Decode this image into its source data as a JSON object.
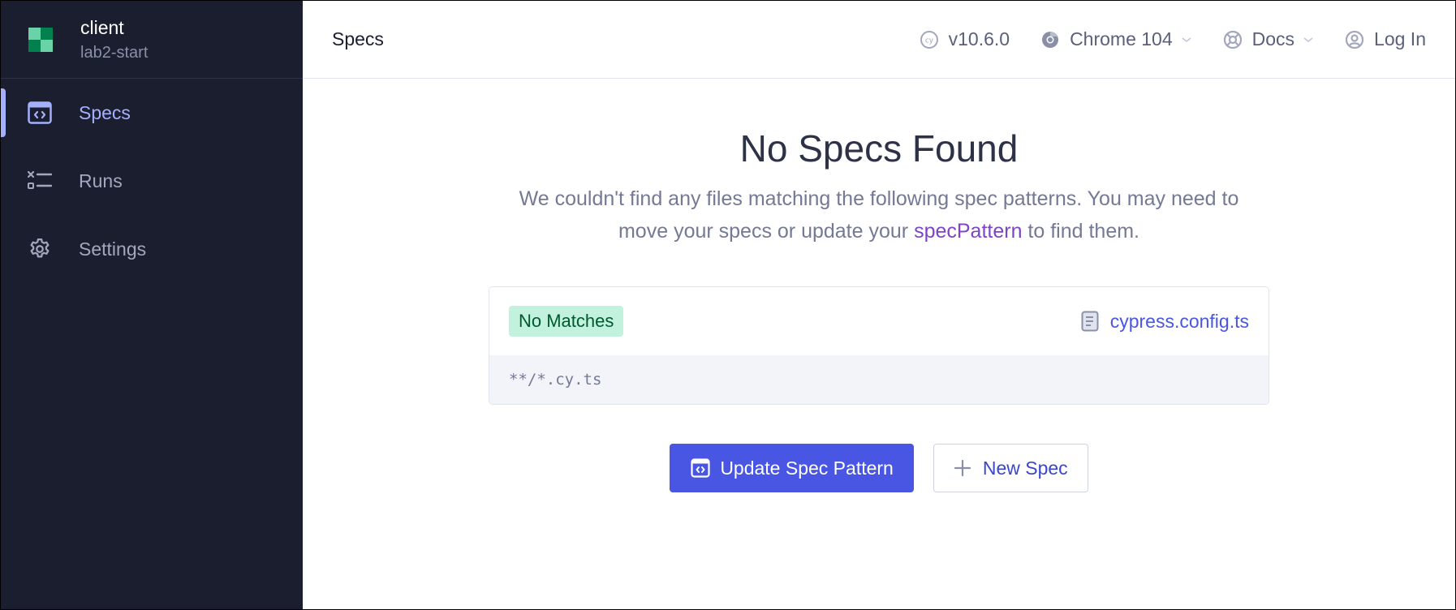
{
  "sidebar": {
    "project": {
      "name": "client",
      "branch": "lab2-start"
    },
    "items": [
      {
        "label": "Specs",
        "icon": "code-window-icon",
        "active": true
      },
      {
        "label": "Runs",
        "icon": "runs-list-icon",
        "active": false
      },
      {
        "label": "Settings",
        "icon": "gear-icon",
        "active": false
      }
    ]
  },
  "header": {
    "title": "Specs",
    "version": "v10.6.0",
    "browser": "Chrome 104",
    "docs": "Docs",
    "login": "Log In"
  },
  "main": {
    "heading": "No Specs Found",
    "description_before": "We couldn't find any files matching the following spec patterns. You may need to move your specs or update your ",
    "description_link": "specPattern",
    "description_after": " to find them.",
    "card": {
      "badge": "No Matches",
      "config_file": "cypress.config.ts",
      "pattern": "**/*.cy.ts"
    },
    "buttons": {
      "update": "Update Spec Pattern",
      "new_spec": "New Spec"
    }
  },
  "colors": {
    "sidebar_bg": "#1b1e2e",
    "accent": "#4956e3",
    "active_nav": "#a5b0fc",
    "badge_bg": "#c2f1de",
    "badge_text": "#00592f",
    "link_purple": "#7f43c9"
  }
}
